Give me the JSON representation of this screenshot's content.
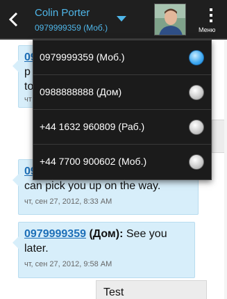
{
  "header": {
    "contact_name": "Colin Porter",
    "contact_phone": "0979999359 (Моб.)",
    "menu_label": "Меню"
  },
  "colors": {
    "accent": "#4fb6e9",
    "header_bg": "#1f1f1f",
    "bubble_in": "#d7eefa",
    "link": "#1d6fb8"
  },
  "icons": [
    "back-icon",
    "dropdown-arrow-icon",
    "contact-photo",
    "menu-icon"
  ],
  "dropdown": {
    "items": [
      {
        "label": "0979999359 (Моб.)",
        "selected": true
      },
      {
        "label": "0988888888 (Дом)",
        "selected": false
      },
      {
        "label": "+44 1632 960809 (Раб.)",
        "selected": false
      },
      {
        "label": "+44 7700 900602 (Моб.)",
        "selected": false
      }
    ]
  },
  "messages": [
    {
      "number": "09",
      "line1": "p",
      "line2": "to",
      "time": "чт"
    },
    {
      "number": "09",
      "text": "can pick you up on the way.",
      "time": "чт, сен 27, 2012, 8:33 AM"
    },
    {
      "number": "0979999359",
      "type": "(Дом):",
      "text_a": "See you",
      "text_b": "later.",
      "time": "чт, сен 27, 2012, 9:58 AM"
    },
    {
      "text": "Test"
    }
  ]
}
